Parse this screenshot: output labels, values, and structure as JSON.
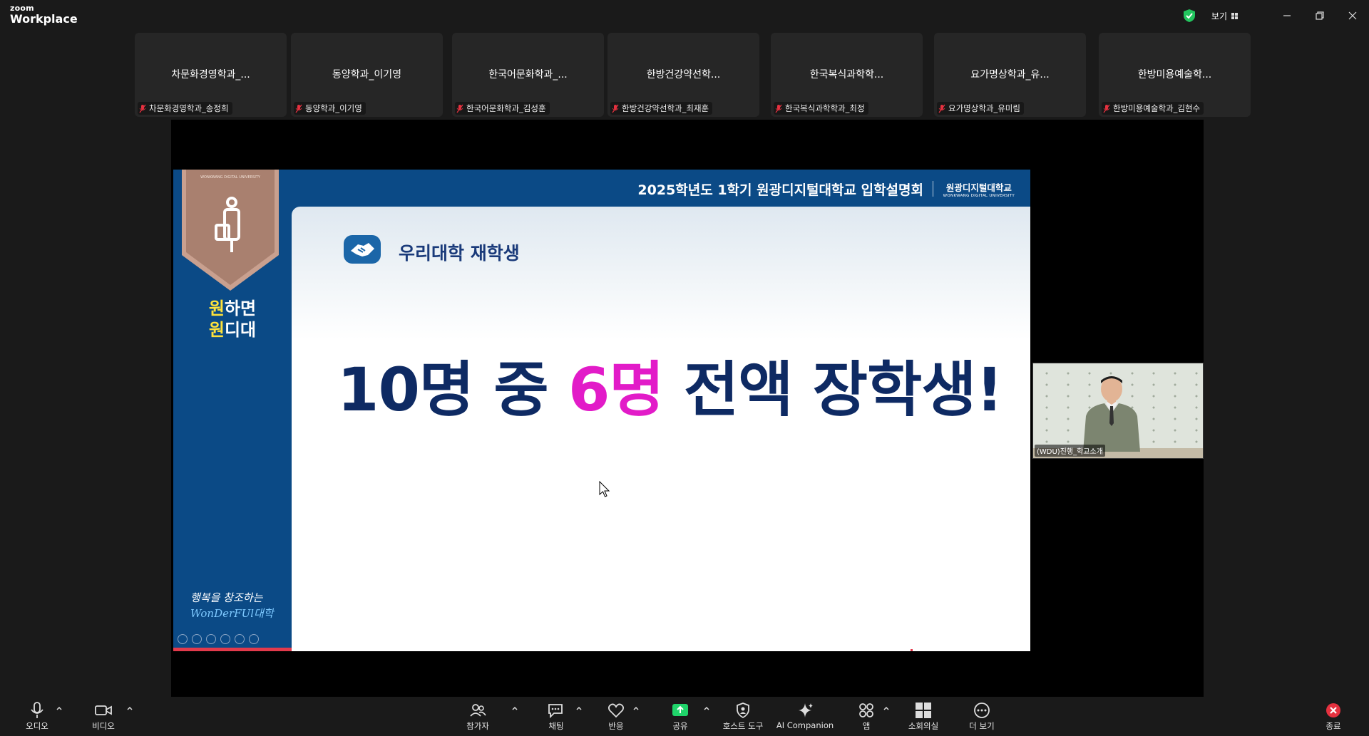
{
  "app": {
    "brand_small": "zoom",
    "brand_large": "Workplace"
  },
  "titlebar": {
    "view_label": "보기"
  },
  "participants": [
    {
      "tile_name": "차문화경영학과_...",
      "label": "차문화경영학과_송정희"
    },
    {
      "tile_name": "동양학과_이기영",
      "label": "동양학과_이기영"
    },
    {
      "tile_name": "한국어문화학과_...",
      "label": "한국어문화학과_김성훈"
    },
    {
      "tile_name": "한방건강약선학...",
      "label": "한방건강약선학과_최재훈"
    },
    {
      "tile_name": "한국복식과학학...",
      "label": "한국복식과학학과_최정"
    },
    {
      "tile_name": "요가명상학과_유...",
      "label": "요가명상학과_유미림"
    },
    {
      "tile_name": "한방미용예술학...",
      "label": "한방미용예술학과_김현수"
    }
  ],
  "slide": {
    "header_title": "2025학년도 1학기 원광디지털대학교 입학설명회",
    "header_logo_korean": "원광디지털대학교",
    "header_logo_english": "WONKWANG DIGITAL UNIVERSITY",
    "badge_text": "WONKWANG DIGITAL UNIVERSITY",
    "slogan_line1_accent": "원",
    "slogan_line1_rest": "하면",
    "slogan_line2_accent": "원",
    "slogan_line2_rest": "디대",
    "signature_line1": "행복을 창조하는",
    "signature_line2": "WonDerFUl대학",
    "subtitle": "우리대학 재학생",
    "headline_part1": "10명 중 ",
    "headline_highlight": "6명",
    "headline_part2": " 전액 장학생!"
  },
  "speaker": {
    "label": "(WDU)진행_학교소개"
  },
  "toolbar": {
    "audio": "오디오",
    "video": "비디오",
    "participants": "참가자",
    "chat": "채팅",
    "reactions": "반응",
    "share": "공유",
    "host_tools": "호스트 도구",
    "ai_companion": "AI Companion",
    "apps": "앱",
    "breakout": "소회의실",
    "more": "더 보기",
    "end": "종료"
  },
  "colors": {
    "slide_navy": "#0b4a86",
    "headline_navy": "#0e2a63",
    "headline_magenta": "#e21bc8",
    "slogan_yellow": "#ffe23a",
    "share_green": "#1fd46a",
    "end_red": "#e5313f"
  }
}
